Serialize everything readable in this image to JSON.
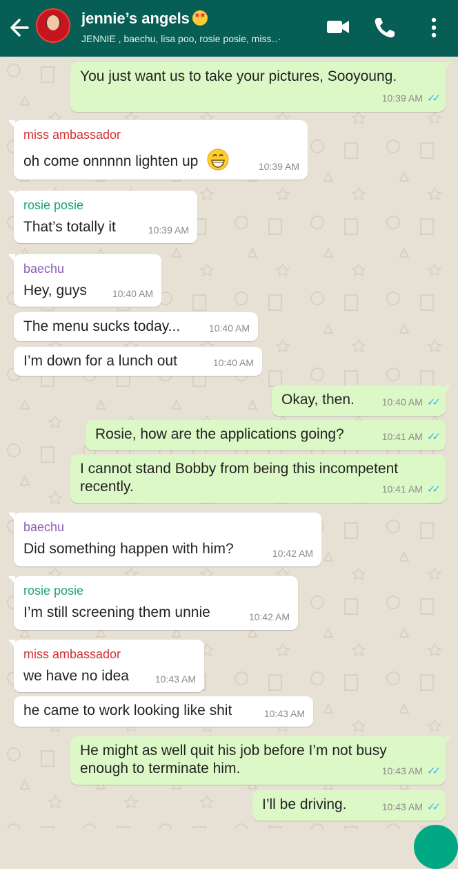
{
  "header": {
    "title": "jennie’s angels",
    "participants": "JENNIE , baechu, lisa poo, rosie posie, miss‥·"
  },
  "colors": {
    "header_bg": "#075e54",
    "outgoing_bg": "#dcf8c6",
    "incoming_bg": "#ffffff",
    "read_ticks": "#34b7f1",
    "sender_miss_ambassador": "#d32f2f",
    "sender_rosie_posie": "#1fa07a",
    "sender_baechu": "#8e5bb5"
  },
  "icons": [
    "back-arrow-icon",
    "video-call-icon",
    "phone-icon",
    "more-vert-icon",
    "grin-emoji-icon",
    "star-struck-emoji-icon",
    "double-check-icon"
  ],
  "messages": [
    {
      "text": "You just want us to take your pictures, Sooyoung.",
      "time": "10:39 AM",
      "ticks": "✓✓"
    },
    {
      "sender": "miss ambassador",
      "text": "oh come onnnnn lighten up",
      "time": "10:39 AM"
    },
    {
      "sender": "rosie posie",
      "text": "That’s totally it",
      "time": "10:39 AM"
    },
    {
      "sender": "baechu",
      "text": "Hey, guys",
      "time": "10:40 AM"
    },
    {
      "text": "The menu sucks today...",
      "time": "10:40 AM"
    },
    {
      "text": "I’m down for a lunch out",
      "time": "10:40 AM"
    },
    {
      "text": "Okay, then.",
      "time": "10:40 AM",
      "ticks": "✓✓"
    },
    {
      "text": "Rosie, how are the applications going?",
      "time": "10:41 AM",
      "ticks": "✓✓"
    },
    {
      "text": "I cannot stand Bobby from being this incompetent recently.",
      "time": "10:41 AM",
      "ticks": "✓✓"
    },
    {
      "sender": "baechu",
      "text": "Did something happen with him?",
      "time": "10:42 AM"
    },
    {
      "sender": "rosie posie",
      "text": "I’m still screening them unnie",
      "time": "10:42 AM"
    },
    {
      "sender": "miss ambassador",
      "text": "we have no idea",
      "time": "10:43 AM"
    },
    {
      "text": "he came to work looking like shit",
      "time": "10:43 AM"
    },
    {
      "text": "He might as well quit his job before I’m not busy enough to terminate him.",
      "time": "10:43 AM",
      "ticks": "✓✓"
    },
    {
      "text": "I’ll be driving.",
      "time": "10:43 AM",
      "ticks": "✓✓"
    }
  ]
}
